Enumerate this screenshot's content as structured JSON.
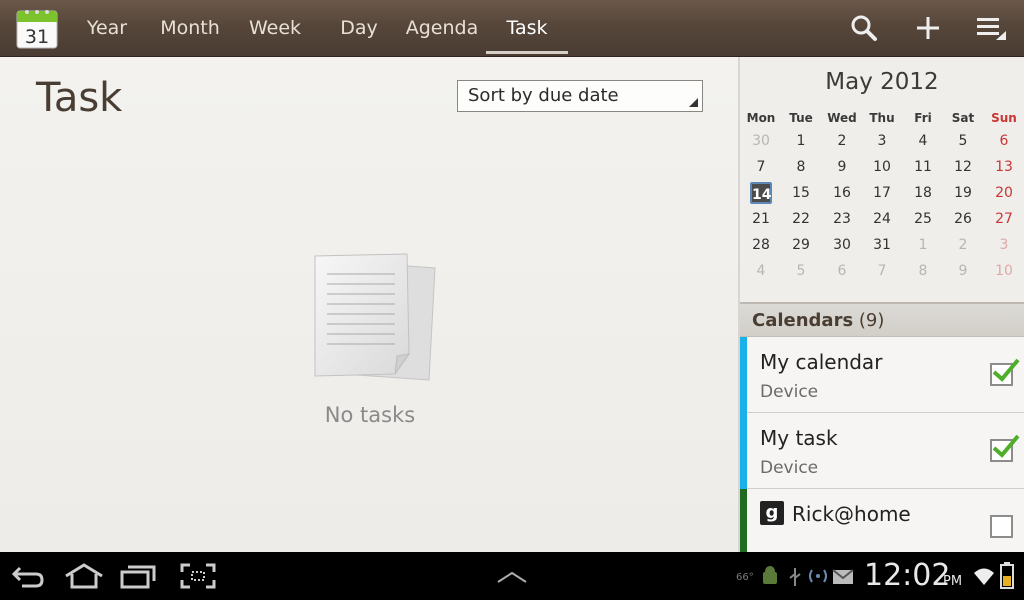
{
  "app": {
    "icon_day": "31",
    "icon_name": "calendar-app-icon"
  },
  "tabs": [
    {
      "label": "Year"
    },
    {
      "label": "Month"
    },
    {
      "label": "Week"
    },
    {
      "label": "Day"
    },
    {
      "label": "Agenda"
    },
    {
      "label": "Task",
      "active": true
    }
  ],
  "actions": {
    "search_icon": "search-icon",
    "add_icon": "add-icon",
    "menu_icon": "menu-icon"
  },
  "main": {
    "title": "Task",
    "sort": {
      "selected": "Sort by due date"
    },
    "empty_text": "No tasks"
  },
  "mini_calendar": {
    "month_label": "May 2012",
    "weekdays": [
      "Mon",
      "Tue",
      "Wed",
      "Thu",
      "Fri",
      "Sat",
      "Sun"
    ],
    "weeks": [
      [
        "30",
        "1",
        "2",
        "3",
        "4",
        "5",
        "6"
      ],
      [
        "7",
        "8",
        "9",
        "10",
        "11",
        "12",
        "13"
      ],
      [
        "14",
        "15",
        "16",
        "17",
        "18",
        "19",
        "20"
      ],
      [
        "21",
        "22",
        "23",
        "24",
        "25",
        "26",
        "27"
      ],
      [
        "28",
        "29",
        "30",
        "31",
        "1",
        "2",
        "3"
      ],
      [
        "4",
        "5",
        "6",
        "7",
        "8",
        "9",
        "10"
      ]
    ],
    "today": "14"
  },
  "calendars": {
    "header_label": "Calendars",
    "count": "(9)",
    "items": [
      {
        "name": "My calendar",
        "sub": "Device",
        "checked": true,
        "color": "#1ab0e8"
      },
      {
        "name": "My task",
        "sub": "Device",
        "checked": true,
        "color": "#1ab0e8"
      },
      {
        "name": "Rick@home",
        "sub": "",
        "checked": false,
        "color": "#1f6b1f",
        "badge": "g"
      }
    ]
  },
  "system": {
    "temperature": "66°",
    "time": "12:02",
    "ampm": "PM"
  },
  "colors": {
    "accent_today": "#5c86b4",
    "sunday": "#c93535",
    "check_green": "#4fae2a"
  }
}
